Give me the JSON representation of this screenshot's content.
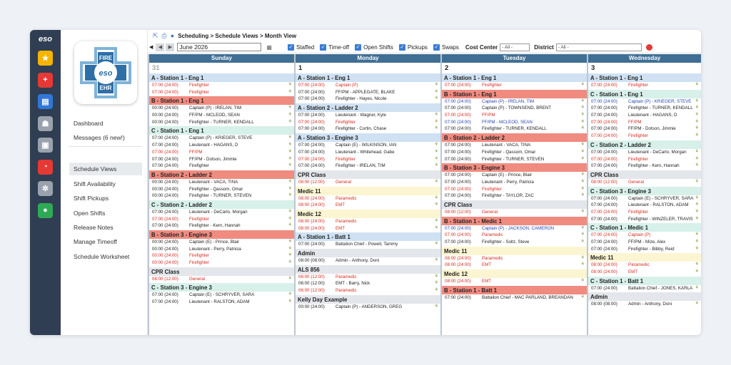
{
  "app": {
    "brand": "eso"
  },
  "logo": {
    "top": "FIRE",
    "middle": "eso",
    "bottom": "EHR"
  },
  "sidebar": {
    "items": [
      "Dashboard",
      "Messages (6 new!)",
      "Schedule Views",
      "Shift Availability",
      "Shift Pickups",
      "Open Shifts",
      "Release Notes",
      "Manage Timeoff",
      "Schedule Worksheet"
    ],
    "active_index": 2
  },
  "rail": {
    "icons": [
      {
        "name": "star-icon",
        "color": "#f5b400",
        "glyph": "★"
      },
      {
        "name": "plus-icon",
        "color": "#e53935",
        "glyph": "+"
      },
      {
        "name": "document-icon",
        "color": "#2f78d8",
        "glyph": "▤"
      },
      {
        "name": "people-icon",
        "color": "#9aa3ad",
        "glyph": "☗"
      },
      {
        "name": "briefcase-icon",
        "color": "#9aa3ad",
        "glyph": "▣"
      },
      {
        "name": "chart-icon",
        "color": "#e53935",
        "glyph": "◔"
      },
      {
        "name": "gear-icon",
        "color": "#9aa3ad",
        "glyph": "✲"
      },
      {
        "name": "user-icon",
        "color": "#2eaa55",
        "glyph": "●"
      }
    ]
  },
  "breadcrumb": "Scheduling > Schedule Views > Month View",
  "toolbar": {
    "month": "June 2026",
    "filters": [
      "Staffed",
      "Time-off",
      "Open Shifts",
      "Pickups",
      "Swaps"
    ],
    "cost_center_label": "Cost Center",
    "cost_center_value": "- All -",
    "district_label": "District",
    "district_value": "- All -"
  },
  "days": [
    {
      "name": "Sunday",
      "date": "31",
      "dim": true,
      "sections": [
        {
          "title": "A - Station 1 - Eng 1",
          "color": "blue",
          "rows": [
            [
              "07:00 (24:00)",
              "Firefighter",
              "red"
            ],
            [
              "07:00 (24:00)",
              "Firefighter",
              "red"
            ]
          ]
        },
        {
          "title": "B - Station 1 - Eng 1",
          "color": "red",
          "rows": [
            [
              "00:00 (24:00)",
              "Captain (P) - IRELAN, TIM",
              ""
            ],
            [
              "00:00 (24:00)",
              "FF/PM - MCLEOD, SEAN",
              ""
            ],
            [
              "00:00 (24:00)",
              "Firefighter - TURNER, KENDALL",
              ""
            ]
          ]
        },
        {
          "title": "C - Station 1 - Eng 1",
          "color": "green",
          "rows": [
            [
              "07:00 (24:00)",
              "Captain (P) - KRIEGER, STEVE",
              ""
            ],
            [
              "07:00 (24:00)",
              "Lieutenant - HAGANS, D",
              ""
            ],
            [
              "07:00 (24:00)",
              "FF/PM",
              "red"
            ],
            [
              "07:00 (24:00)",
              "FF/PM - Dotson, Jimmie",
              ""
            ],
            [
              "07:00 (24:00)",
              "Firefighter",
              ""
            ]
          ]
        },
        {
          "title": "B - Station 2 - Ladder 2",
          "color": "red",
          "rows": [
            [
              "00:00 (24:00)",
              "Lieutenant - VACA, TINA",
              ""
            ],
            [
              "00:00 (24:00)",
              "Firefighter - Qassom, Omar",
              ""
            ],
            [
              "00:00 (24:00)",
              "Firefighter - TURNER, STEVEN",
              ""
            ]
          ]
        },
        {
          "title": "C - Station 2 - Ladder 2",
          "color": "green",
          "rows": [
            [
              "07:00 (24:00)",
              "Lieutenant - DeCarlo, Morgan",
              ""
            ],
            [
              "07:00 (24:00)",
              "Firefighter",
              "red"
            ],
            [
              "07:00 (24:00)",
              "Firefighter - Kern, Hannah",
              ""
            ]
          ]
        },
        {
          "title": "B - Station 3 - Engine 3",
          "color": "red",
          "rows": [
            [
              "00:00 (24:00)",
              "Captain (E) - Prince, Blair",
              ""
            ],
            [
              "00:00 (24:00)",
              "Lieutenant - Perry, Patricia",
              ""
            ],
            [
              "00:00 (24:00)",
              "Firefighter",
              "red"
            ],
            [
              "00:00 (24:00)",
              "Firefighter",
              "red"
            ]
          ]
        },
        {
          "title": "CPR Class",
          "color": "gray",
          "rows": [
            [
              "08:00 (12:00)",
              "General",
              "red"
            ]
          ]
        },
        {
          "title": "C - Station 3 - Engine 3",
          "color": "green",
          "rows": [
            [
              "07:00 (24:00)",
              "Captain (E) - SCHRYVER, SARA",
              ""
            ],
            [
              "07:00 (24:00)",
              "Lieutenant - RALSTON, ADAM",
              ""
            ]
          ]
        }
      ]
    },
    {
      "name": "Monday",
      "date": "1",
      "dim": false,
      "sections": [
        {
          "title": "A - Station 1 - Eng 1",
          "color": "blue",
          "rows": [
            [
              "07:00 (24:00)",
              "Captain (P)",
              "red"
            ],
            [
              "07:00 (24:00)",
              "FF/PM - APPLEGATE, BLAKE",
              ""
            ],
            [
              "07:00 (24:00)",
              "Firefighter - Hayes, Nicole",
              ""
            ]
          ]
        },
        {
          "title": "A - Station 2 - Ladder 2",
          "color": "blue",
          "rows": [
            [
              "07:00 (24:00)",
              "Lieutenant - Wagner, Kyle",
              ""
            ],
            [
              "07:00 (24:00)",
              "Firefighter",
              "red"
            ],
            [
              "07:00 (24:00)",
              "Firefighter - Curtin, Chase",
              ""
            ]
          ]
        },
        {
          "title": "A - Station 3 - Engine 3",
          "color": "blue",
          "rows": [
            [
              "07:00 (24:00)",
              "Captain (E) - WILKINSON, IAN",
              ""
            ],
            [
              "07:00 (24:00)",
              "Lieutenant - Whitehead, Gabe",
              ""
            ],
            [
              "07:00 (24:00)",
              "Firefighter",
              "red"
            ],
            [
              "07:00 (24:00)",
              "Firefighter - IRELAN, TIM",
              ""
            ]
          ]
        },
        {
          "title": "CPR Class",
          "color": "gray",
          "rows": [
            [
              "08:00 (12:00)",
              "General",
              "red"
            ]
          ]
        },
        {
          "title": "Medic 11",
          "color": "yellow",
          "rows": [
            [
              "08:00 (24:00)",
              "Paramedic",
              "red"
            ],
            [
              "08:00 (24:00)",
              "EMT",
              "red"
            ]
          ]
        },
        {
          "title": "Medic 12",
          "color": "yellow",
          "rows": [
            [
              "08:00 (24:00)",
              "Paramedic",
              "red"
            ],
            [
              "08:00 (24:00)",
              "EMT",
              "red"
            ]
          ]
        },
        {
          "title": "A - Station 1 - Batt 1",
          "color": "blue",
          "rows": [
            [
              "07:00 (24:00)",
              "Battalion Chief - Powell, Tammy",
              ""
            ]
          ]
        },
        {
          "title": "Admin",
          "color": "gray",
          "rows": [
            [
              "08:00 (08:00)",
              "Admin - Anthony, Doni",
              ""
            ]
          ]
        },
        {
          "title": "ALS 856",
          "color": "gray",
          "rows": [
            [
              "06:00 (12:00)",
              "Paramedic",
              "red"
            ],
            [
              "06:00 (12:00)",
              "EMT - Barry, Nick",
              ""
            ],
            [
              "06:00 (12:00)",
              "Paramedic",
              "red"
            ]
          ]
        },
        {
          "title": "Kelly Day Example",
          "color": "gray",
          "rows": [
            [
              "00:00 (24:00)",
              "Captain (P) - ANDERSON, GREG",
              ""
            ]
          ]
        }
      ]
    },
    {
      "name": "Tuesday",
      "date": "2",
      "dim": false,
      "sections": [
        {
          "title": "A - Station 1 - Eng 1",
          "color": "blue",
          "rows": [
            [
              "07:00 (24:00)",
              "Firefighter",
              "red"
            ]
          ]
        },
        {
          "title": "B - Station 1 - Eng 1",
          "color": "red",
          "rows": [
            [
              "07:00 (24:00)",
              "Captain (P) - IRELAN, TIM",
              "blue"
            ],
            [
              "07:00 (24:00)",
              "Captain (P) - TOWNSEND, BRENT",
              ""
            ],
            [
              "07:00 (24:00)",
              "FF/PM",
              "red"
            ],
            [
              "07:00 (24:00)",
              "FF/PM - MCLEOD, SEAN",
              "blue"
            ],
            [
              "07:00 (24:00)",
              "Firefighter - TURNER, KENDALL",
              ""
            ]
          ]
        },
        {
          "title": "B - Station 2 - Ladder 2",
          "color": "red",
          "rows": [
            [
              "07:00 (24:00)",
              "Lieutenant - VACA, TINA",
              ""
            ],
            [
              "07:00 (24:00)",
              "Firefighter - Qassom, Omar",
              ""
            ],
            [
              "07:00 (24:00)",
              "Firefighter - TURNER, STEVEN",
              ""
            ]
          ]
        },
        {
          "title": "B - Station 3 - Engine 3",
          "color": "red",
          "rows": [
            [
              "07:00 (24:00)",
              "Captain (E) - Prince, Blair",
              ""
            ],
            [
              "07:00 (24:00)",
              "Lieutenant - Perry, Patricia",
              ""
            ],
            [
              "07:00 (24:00)",
              "Firefighter",
              "red"
            ],
            [
              "07:00 (24:00)",
              "Firefighter - TAYLOR, ZAC",
              ""
            ]
          ]
        },
        {
          "title": "CPR Class",
          "color": "gray",
          "rows": [
            [
              "08:00 (12:00)",
              "General",
              "red"
            ]
          ]
        },
        {
          "title": "B - Station 1 - Medic 1",
          "color": "red",
          "rows": [
            [
              "07:00 (24:00)",
              "Captain (P) - JACKSON, CAMERON",
              "blue"
            ],
            [
              "07:00 (24:00)",
              "Paramedic",
              "red"
            ],
            [
              "07:00 (24:00)",
              "Firefighter - Soltz, Steve",
              ""
            ]
          ]
        },
        {
          "title": "Medic 11",
          "color": "yellow",
          "rows": [
            [
              "08:00 (24:00)",
              "Paramedic",
              "red"
            ],
            [
              "08:00 (24:00)",
              "EMT",
              "red"
            ]
          ]
        },
        {
          "title": "Medic 12",
          "color": "yellow",
          "rows": [
            [
              "08:00 (24:00)",
              "EMT",
              "red"
            ]
          ]
        },
        {
          "title": "B - Station 1 - Batt 1",
          "color": "red",
          "rows": [
            [
              "07:00 (24:00)",
              "Battalion Chief - MAC PARLAND, BREANDAN",
              ""
            ]
          ]
        }
      ]
    },
    {
      "name": "Wednesday",
      "date": "3",
      "dim": false,
      "sections": [
        {
          "title": "A - Station 1 - Eng 1",
          "color": "blue",
          "rows": [
            [
              "07:00 (24:00)",
              "Firefighter",
              "red"
            ]
          ]
        },
        {
          "title": "C - Station 1 - Eng 1",
          "color": "green",
          "rows": [
            [
              "07:00 (24:00)",
              "Captain (P) - KRIEGER, STEVE",
              "blue"
            ],
            [
              "07:00 (24:00)",
              "Firefighter - TURNER, KENDALL",
              ""
            ],
            [
              "07:00 (24:00)",
              "Lieutenant - HAGANS, D",
              ""
            ],
            [
              "07:00 (24:00)",
              "FF/PM",
              "red"
            ],
            [
              "07:00 (24:00)",
              "FF/PM - Dotson, Jimmie",
              ""
            ],
            [
              "07:00 (24:00)",
              "Firefighter",
              "red"
            ]
          ]
        },
        {
          "title": "C - Station 2 - Ladder 2",
          "color": "green",
          "rows": [
            [
              "07:00 (24:00)",
              "Lieutenant - DeCarlo, Morgan",
              ""
            ],
            [
              "07:00 (24:00)",
              "Firefighter",
              "red"
            ],
            [
              "07:00 (24:00)",
              "Firefighter - Kern, Hannah",
              ""
            ]
          ]
        },
        {
          "title": "CPR Class",
          "color": "gray",
          "rows": [
            [
              "08:00 (12:00)",
              "General",
              "red"
            ]
          ]
        },
        {
          "title": "C - Station 3 - Engine 3",
          "color": "green",
          "rows": [
            [
              "07:00 (24:00)",
              "Captain (E) - SCHRYVER, SARA",
              ""
            ],
            [
              "07:00 (24:00)",
              "Lieutenant - RALSTON, ADAM",
              ""
            ],
            [
              "07:00 (24:00)",
              "Firefighter",
              "red"
            ],
            [
              "07:00 (24:00)",
              "Firefighter - WINZELER, TRAVIS",
              ""
            ]
          ]
        },
        {
          "title": "C - Station 1 - Medic 1",
          "color": "green",
          "rows": [
            [
              "07:00 (24:00)",
              "Captain (P)",
              "red"
            ],
            [
              "07:00 (24:00)",
              "FF/PM - Mize, Alex",
              ""
            ],
            [
              "07:00 (24:00)",
              "Firefighter - Bibby, Reid",
              ""
            ]
          ]
        },
        {
          "title": "Medic 11",
          "color": "yellow",
          "rows": [
            [
              "08:00 (24:00)",
              "Paramedic",
              "red"
            ],
            [
              "08:00 (24:00)",
              "EMT",
              "red"
            ]
          ]
        },
        {
          "title": "C - Station 1 - Batt 1",
          "color": "green",
          "rows": [
            [
              "07:00 (24:00)",
              "Battalion Chief - JONES, KARLA",
              ""
            ]
          ]
        },
        {
          "title": "Admin",
          "color": "gray",
          "rows": [
            [
              "08:00 (08:00)",
              "Admin - Anthony, Doni",
              ""
            ]
          ]
        }
      ]
    }
  ]
}
